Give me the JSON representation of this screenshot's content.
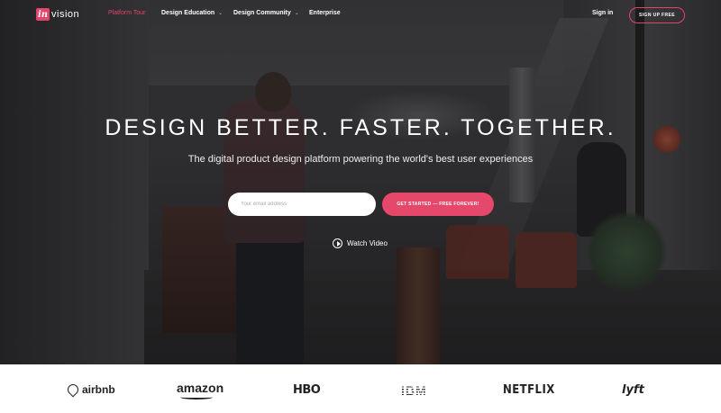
{
  "brand": {
    "logo_mark": "in",
    "logo_text": "vision",
    "accent_color": "#e2446a"
  },
  "nav": {
    "items": [
      {
        "label": "Platform Tour",
        "active": true,
        "dropdown": false
      },
      {
        "label": "Design Education",
        "active": false,
        "dropdown": true
      },
      {
        "label": "Design Community",
        "active": false,
        "dropdown": true
      },
      {
        "label": "Enterprise",
        "active": false,
        "dropdown": false
      }
    ],
    "sign_in": "Sign in",
    "sign_up": "SIGN UP FREE",
    "chevron_icon": "chevron-down-icon"
  },
  "hero": {
    "headline": "DESIGN BETTER. FASTER. TOGETHER.",
    "subline": "The digital product design platform powering the world's best user experiences",
    "email_placeholder": "Your email address",
    "email_value": "",
    "cta": "GET STARTED — FREE FOREVER!",
    "watch_video": "Watch Video",
    "play_icon": "play-circle-icon"
  },
  "logos": [
    "airbnb",
    "amazon",
    "HBO",
    "IBM",
    "NETFLIX",
    "lyft"
  ]
}
